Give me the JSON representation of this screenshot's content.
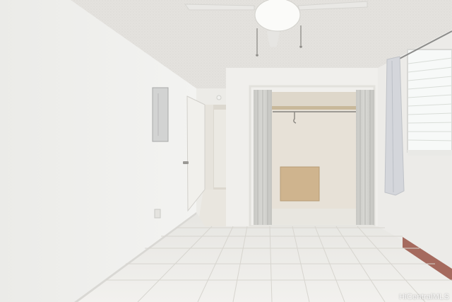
{
  "photo": {
    "watermark": "HiCentralMLS"
  }
}
